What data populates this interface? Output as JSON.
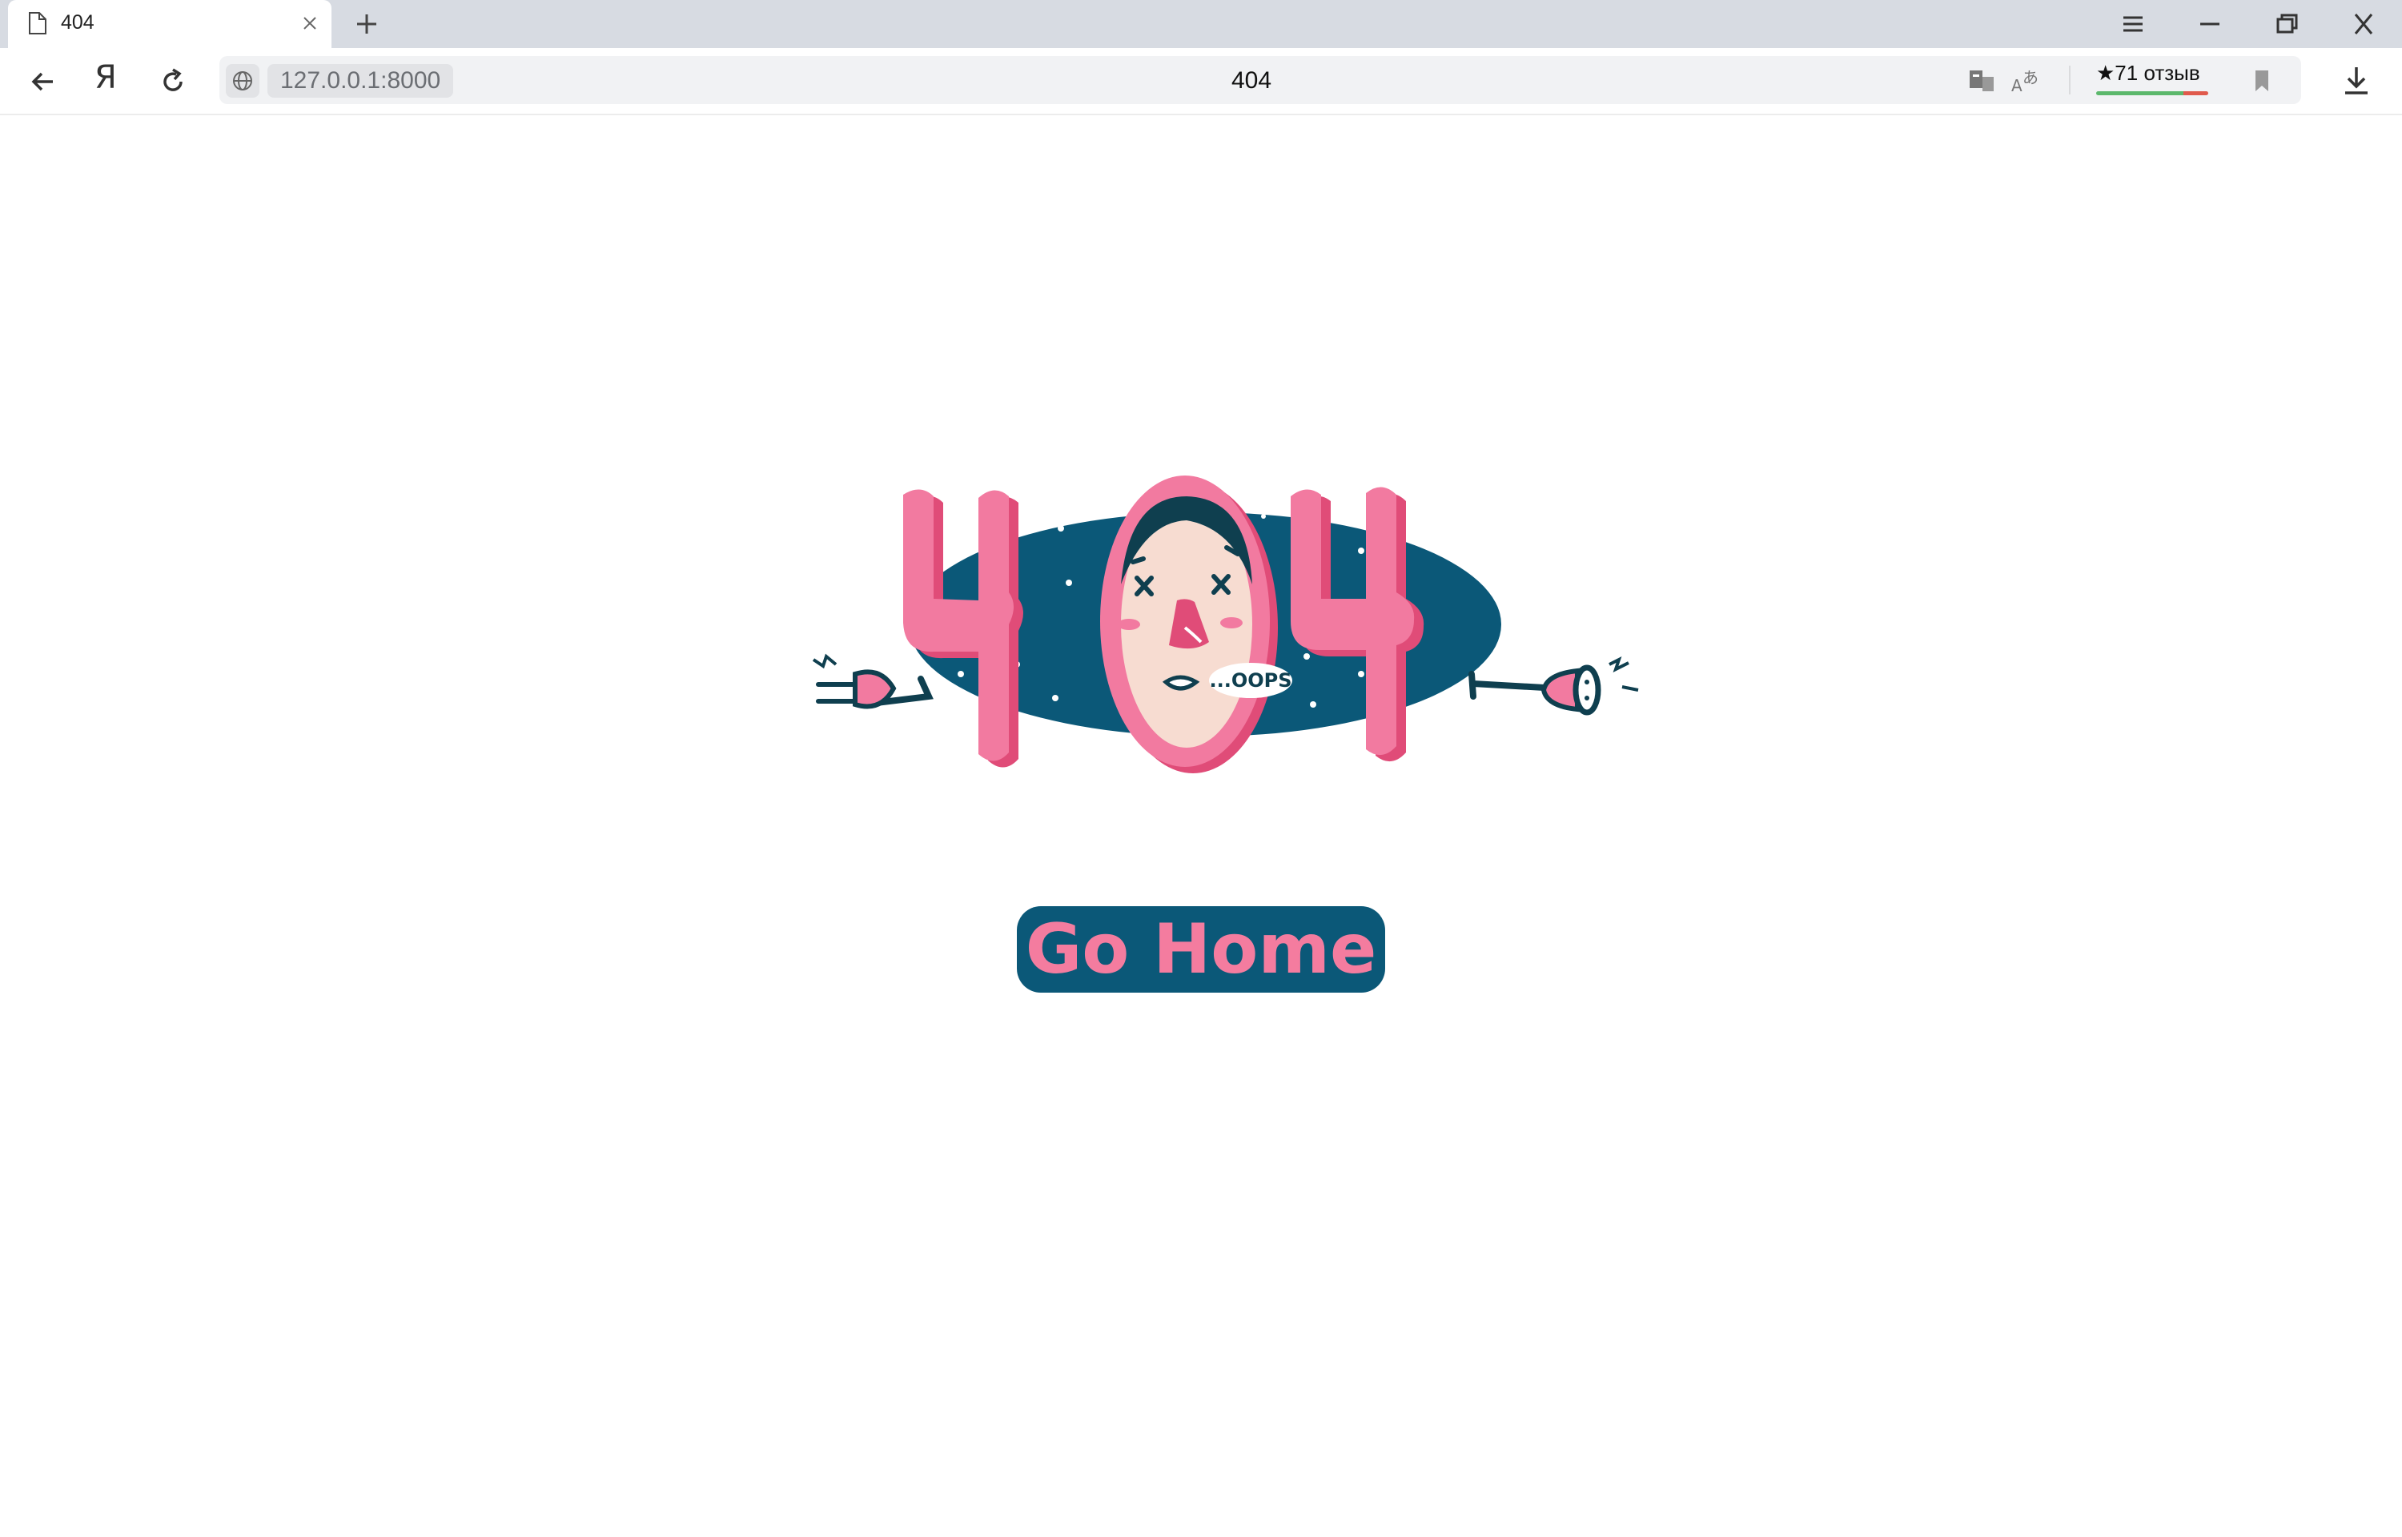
{
  "browser": {
    "tab": {
      "title": "404"
    },
    "address": {
      "url": "127.0.0.1:8000",
      "page_title": "404"
    },
    "reviews": {
      "label": "★71 отзыв"
    },
    "icons": [
      "document-icon",
      "close-icon",
      "plus-icon",
      "menu-icon",
      "minimize-icon",
      "restore-icon",
      "window-close-icon",
      "back-icon",
      "yandex-logo",
      "refresh-icon",
      "globe-icon",
      "reader-mode-icon",
      "translate-icon",
      "bookmark-icon",
      "download-icon"
    ]
  },
  "page": {
    "illustration": {
      "speech_bubble": "...OOPS"
    },
    "home_button": {
      "label": "Go Home"
    }
  },
  "colors": {
    "pink": "#f27aa0",
    "pink_dark": "#e04c78",
    "navy": "#0b5878",
    "dark": "#0f3f4f",
    "face": "#f7dcd1",
    "tabstrip": "#d7dbe2"
  }
}
